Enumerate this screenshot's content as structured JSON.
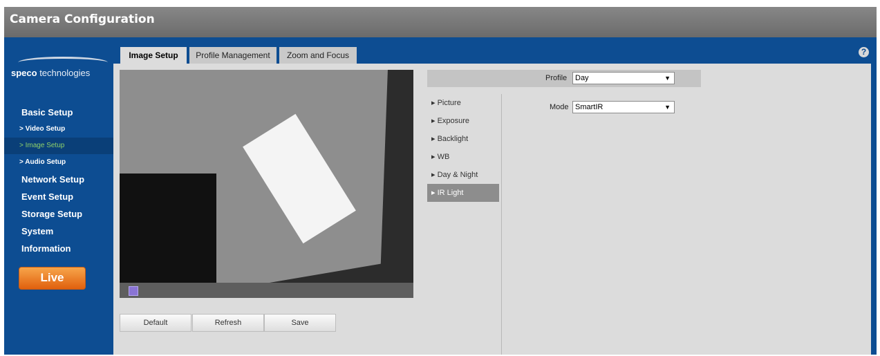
{
  "window": {
    "title": "Camera Configuration"
  },
  "brand": {
    "logo_bold": "speco",
    "logo_rest": " technologies"
  },
  "sidebar": {
    "items": [
      {
        "label": "Basic Setup",
        "type": "heading"
      },
      {
        "label": "> Video Setup",
        "type": "sub"
      },
      {
        "label": "> Image Setup",
        "type": "sub",
        "active": true
      },
      {
        "label": "> Audio Setup",
        "type": "sub"
      },
      {
        "label": "Network Setup",
        "type": "heading"
      },
      {
        "label": "Event Setup",
        "type": "heading"
      },
      {
        "label": "Storage Setup",
        "type": "heading"
      },
      {
        "label": "System",
        "type": "heading"
      },
      {
        "label": "Information",
        "type": "heading"
      }
    ],
    "live_label": "Live"
  },
  "help_icon": "?",
  "tabs": [
    {
      "label": "Image Setup",
      "active": true
    },
    {
      "label": "Profile Management"
    },
    {
      "label": "Zoom and Focus"
    }
  ],
  "buttons": {
    "default": "Default",
    "refresh": "Refresh",
    "save": "Save"
  },
  "profile": {
    "label": "Profile",
    "value": "Day"
  },
  "mode": {
    "label": "Mode",
    "value": "SmartIR"
  },
  "settings_menu": [
    {
      "label": "▸ Picture"
    },
    {
      "label": "▸ Exposure"
    },
    {
      "label": "▸ Backlight"
    },
    {
      "label": "▸ WB"
    },
    {
      "label": "▸ Day & Night"
    },
    {
      "label": "▸ IR Light",
      "active": true
    }
  ],
  "colors": {
    "accent_blue": "#0d4d92",
    "live_orange": "#e0600e",
    "active_green": "#8fd16a"
  },
  "icons": {
    "help": "help-icon",
    "fullscreen": "fullscreen-icon",
    "dropdown": "chevron-down-icon"
  }
}
